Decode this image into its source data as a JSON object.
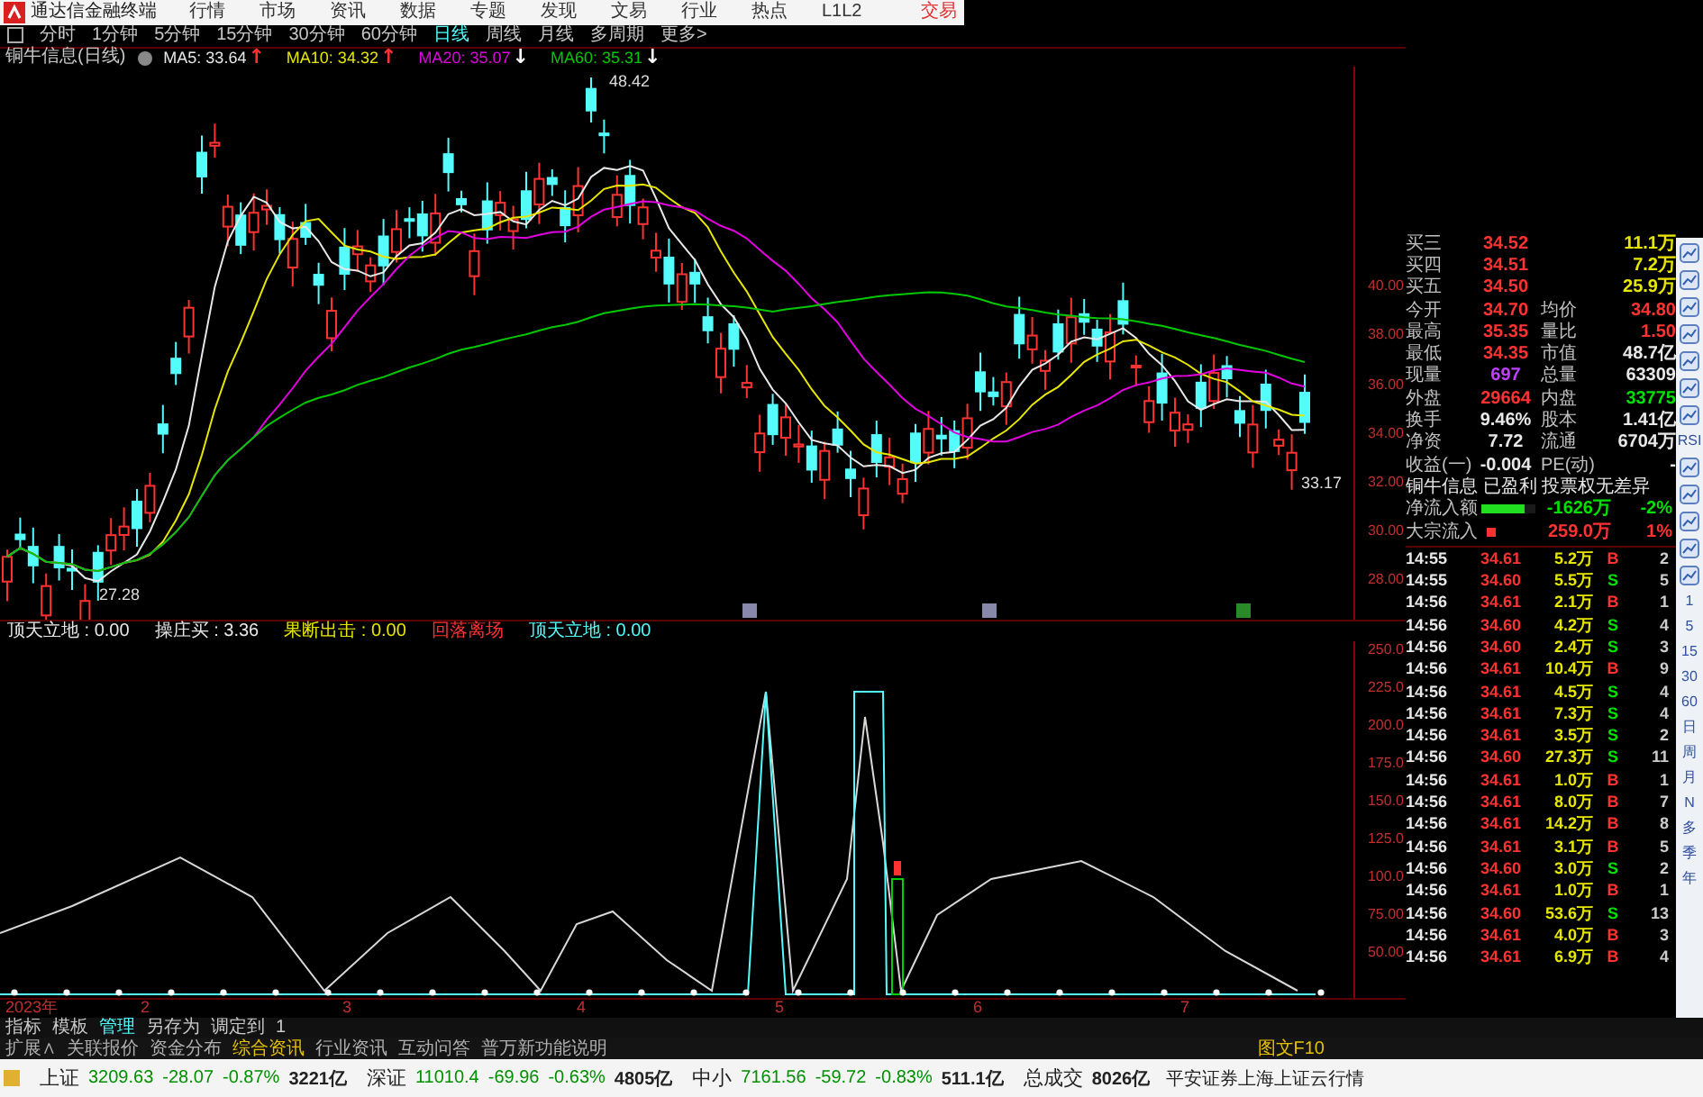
{
  "app_bar": {
    "title": "通达信金融终端",
    "menus": [
      "行情",
      "市场",
      "资讯",
      "数据",
      "专题",
      "发现",
      "文易",
      "行业",
      "热点",
      "L1L2"
    ],
    "trade": "交易"
  },
  "periods": [
    {
      "label": "分时",
      "selected": false
    },
    {
      "label": "1分钟",
      "selected": false
    },
    {
      "label": "5分钟",
      "selected": false
    },
    {
      "label": "15分钟",
      "selected": false
    },
    {
      "label": "30分钟",
      "selected": false
    },
    {
      "label": "60分钟",
      "selected": false
    },
    {
      "label": "日线",
      "selected": true
    },
    {
      "label": "周线",
      "selected": false
    },
    {
      "label": "月线",
      "selected": false
    },
    {
      "label": "多周期",
      "selected": false
    },
    {
      "label": "更多>",
      "selected": false
    }
  ],
  "chart_title": "铜牛信息(日线)",
  "moving_averages": [
    {
      "label": "MA5: 33.64",
      "color": "#e8e8e8",
      "arrow": {
        "text": "↑",
        "color": "#ff3232"
      }
    },
    {
      "label": "MA10: 34.32",
      "color": "#e6e600",
      "arrow": {
        "text": "↑",
        "color": "#ff3232"
      }
    },
    {
      "label": "MA20: 35.07",
      "color": "#e000e0",
      "arrow": {
        "text": "↓",
        "color": "#ffffff"
      }
    },
    {
      "label": "MA60: 35.31",
      "color": "#00c800",
      "arrow": {
        "text": "↓",
        "color": "#ffffff"
      }
    }
  ],
  "main_chart": {
    "high_label": "48.42",
    "low_label": "27.28",
    "last_label": "33.17",
    "axis": [
      "40.00",
      "38.00",
      "36.00",
      "34.00",
      "32.00",
      "30.00",
      "28.00"
    ]
  },
  "indicator_header": [
    {
      "text": "顶天立地 : 0.00",
      "color": "#e8e8e8"
    },
    {
      "text": "操庄买 : 3.36",
      "color": "#e8e8e8"
    },
    {
      "text": "果断出击 : 0.00",
      "color": "#e6e600"
    },
    {
      "text": "回落离场",
      "color": "#ff3232"
    },
    {
      "text": "顶天立地 : 0.00",
      "color": "#54fcfc"
    }
  ],
  "indicator_axis": [
    "250.0",
    "225.0",
    "200.0",
    "175.0",
    "150.0",
    "125.0",
    "100.0",
    "75.00",
    "50.00"
  ],
  "x_axis": [
    "2023年",
    "2",
    "3",
    "4",
    "5",
    "6",
    "7"
  ],
  "quote": [
    {
      "kind": "order",
      "cells": [
        {
          "text": "买三",
          "color": "#c0c0c0"
        },
        {
          "text": "34.52",
          "color": "#ff3232"
        },
        {
          "text": "11.1万",
          "color": "#e6e600"
        }
      ]
    },
    {
      "kind": "order",
      "cells": [
        {
          "text": "买四",
          "color": "#c0c0c0"
        },
        {
          "text": "34.51",
          "color": "#ff3232"
        },
        {
          "text": "7.2万",
          "color": "#e6e600"
        }
      ]
    },
    {
      "kind": "order",
      "cells": [
        {
          "text": "买五",
          "color": "#c0c0c0"
        },
        {
          "text": "34.50",
          "color": "#ff3232"
        },
        {
          "text": "25.9万",
          "color": "#e6e600"
        }
      ]
    },
    {
      "kind": "pair",
      "cells": [
        {
          "text": "今开",
          "color": "#c0c0c0"
        },
        {
          "text": "34.70",
          "color": "#ff3232"
        },
        {
          "text": "均价",
          "color": "#c0c0c0"
        },
        {
          "text": "34.80",
          "color": "#ff3232"
        }
      ]
    },
    {
      "kind": "pair",
      "cells": [
        {
          "text": "最高",
          "color": "#c0c0c0"
        },
        {
          "text": "35.35",
          "color": "#ff3232"
        },
        {
          "text": "量比",
          "color": "#c0c0c0"
        },
        {
          "text": "1.50",
          "color": "#ff3232"
        }
      ]
    },
    {
      "kind": "pair",
      "cells": [
        {
          "text": "最低",
          "color": "#c0c0c0"
        },
        {
          "text": "34.35",
          "color": "#ff3232"
        },
        {
          "text": "市值",
          "color": "#c0c0c0"
        },
        {
          "text": "48.7亿",
          "color": "#e8e8e8"
        }
      ]
    },
    {
      "kind": "pair",
      "cells": [
        {
          "text": "现量",
          "color": "#c0c0c0"
        },
        {
          "text": "697",
          "color": "#c040ff"
        },
        {
          "text": "总量",
          "color": "#c0c0c0"
        },
        {
          "text": "63309",
          "color": "#e8e8e8"
        }
      ]
    },
    {
      "kind": "pair",
      "cells": [
        {
          "text": "外盘",
          "color": "#c0c0c0"
        },
        {
          "text": "29664",
          "color": "#ff3232"
        },
        {
          "text": "内盘",
          "color": "#c0c0c0"
        },
        {
          "text": "33775",
          "color": "#00e000"
        }
      ]
    },
    {
      "kind": "pair",
      "cells": [
        {
          "text": "换手",
          "color": "#c0c0c0"
        },
        {
          "text": "9.46%",
          "color": "#e8e8e8"
        },
        {
          "text": "股本",
          "color": "#c0c0c0"
        },
        {
          "text": "1.41亿",
          "color": "#e8e8e8"
        }
      ]
    },
    {
      "kind": "pair",
      "cells": [
        {
          "text": "净资",
          "color": "#c0c0c0"
        },
        {
          "text": "7.72",
          "color": "#e8e8e8"
        },
        {
          "text": "流通",
          "color": "#c0c0c0"
        },
        {
          "text": "6704万",
          "color": "#e8e8e8"
        }
      ]
    },
    {
      "kind": "pair",
      "cells": [
        {
          "text": "收益(一)",
          "color": "#c0c0c0"
        },
        {
          "text": "-0.004",
          "color": "#e8e8e8"
        },
        {
          "text": "PE(动)",
          "color": "#c0c0c0"
        },
        {
          "text": "-",
          "color": "#e8e8e8"
        }
      ]
    },
    {
      "kind": "info",
      "cells": [
        {
          "text": "铜牛信息 已盈利 投票权无差异",
          "color": "#e8e8e8"
        }
      ]
    },
    {
      "kind": "flow_bar",
      "level": 0.8,
      "cells": [
        {
          "text": "净流入额",
          "color": "#c0c0c0"
        },
        {
          "text": "-1626万",
          "color": "#00e000"
        },
        {
          "text": "-2%",
          "color": "#00e000"
        }
      ]
    },
    {
      "kind": "flow_dot",
      "cells": [
        {
          "text": "大宗流入",
          "color": "#c0c0c0"
        },
        {
          "text": "259.0万",
          "color": "#ff3232"
        },
        {
          "text": "1%",
          "color": "#ff3232"
        }
      ]
    }
  ],
  "ticks": [
    {
      "time": "14:55",
      "price": "34.61",
      "volume": "5.2万",
      "side": "B",
      "kind": "buy",
      "count": "2"
    },
    {
      "time": "14:55",
      "price": "34.60",
      "volume": "5.5万",
      "side": "S",
      "kind": "sell",
      "count": "5"
    },
    {
      "time": "14:56",
      "price": "34.61",
      "volume": "2.1万",
      "side": "B",
      "kind": "buy",
      "count": "1"
    },
    {
      "time": "14:56",
      "price": "34.60",
      "volume": "4.2万",
      "side": "S",
      "kind": "sell",
      "count": "4"
    },
    {
      "time": "14:56",
      "price": "34.60",
      "volume": "2.4万",
      "side": "S",
      "kind": "sell",
      "count": "3"
    },
    {
      "time": "14:56",
      "price": "34.61",
      "volume": "10.4万",
      "side": "B",
      "kind": "buy",
      "count": "9"
    },
    {
      "time": "14:56",
      "price": "34.61",
      "volume": "4.5万",
      "side": "S",
      "kind": "sell",
      "count": "4"
    },
    {
      "time": "14:56",
      "price": "34.61",
      "volume": "7.3万",
      "side": "S",
      "kind": "sell",
      "count": "4"
    },
    {
      "time": "14:56",
      "price": "34.61",
      "volume": "3.5万",
      "side": "S",
      "kind": "sell",
      "count": "2"
    },
    {
      "time": "14:56",
      "price": "34.60",
      "volume": "27.3万",
      "side": "S",
      "kind": "sell",
      "count": "11"
    },
    {
      "time": "14:56",
      "price": "34.61",
      "volume": "1.0万",
      "side": "B",
      "kind": "buy",
      "count": "1"
    },
    {
      "time": "14:56",
      "price": "34.61",
      "volume": "8.0万",
      "side": "B",
      "kind": "buy",
      "count": "7"
    },
    {
      "time": "14:56",
      "price": "34.61",
      "volume": "14.2万",
      "side": "B",
      "kind": "buy",
      "count": "8"
    },
    {
      "time": "14:56",
      "price": "34.61",
      "volume": "3.1万",
      "side": "B",
      "kind": "buy",
      "count": "5"
    },
    {
      "time": "14:56",
      "price": "34.60",
      "volume": "3.0万",
      "side": "S",
      "kind": "sell",
      "count": "2"
    },
    {
      "time": "14:56",
      "price": "34.61",
      "volume": "1.0万",
      "side": "B",
      "kind": "buy",
      "count": "1"
    },
    {
      "time": "14:56",
      "price": "34.60",
      "volume": "53.6万",
      "side": "S",
      "kind": "sell",
      "count": "13"
    },
    {
      "time": "14:56",
      "price": "34.61",
      "volume": "4.0万",
      "side": "B",
      "kind": "buy",
      "count": "3"
    },
    {
      "time": "14:56",
      "price": "34.61",
      "volume": "6.9万",
      "side": "B",
      "kind": "buy",
      "count": "4"
    }
  ],
  "toolbar": [
    {
      "kind": "icon"
    },
    {
      "kind": "icon"
    },
    {
      "kind": "icon"
    },
    {
      "kind": "icon"
    },
    {
      "kind": "icon"
    },
    {
      "kind": "icon"
    },
    {
      "kind": "icon"
    },
    {
      "kind": "text",
      "label": "RSI"
    },
    {
      "kind": "icon"
    },
    {
      "kind": "icon"
    },
    {
      "kind": "icon"
    },
    {
      "kind": "icon"
    },
    {
      "kind": "icon"
    },
    {
      "kind": "text",
      "label": "1"
    },
    {
      "kind": "text",
      "label": "5"
    },
    {
      "kind": "text",
      "label": "15"
    },
    {
      "kind": "text",
      "label": "30"
    },
    {
      "kind": "text",
      "label": "60"
    },
    {
      "kind": "text",
      "label": "日"
    },
    {
      "kind": "text",
      "label": "周"
    },
    {
      "kind": "text",
      "label": "月"
    },
    {
      "kind": "text",
      "label": "N"
    },
    {
      "kind": "text",
      "label": "多"
    },
    {
      "kind": "text",
      "label": "季"
    },
    {
      "kind": "text",
      "label": "年"
    }
  ],
  "indicator_tabs": [
    {
      "label": "指标",
      "selected": false
    },
    {
      "label": "模板",
      "selected": false
    },
    {
      "label": "管理",
      "selected": true
    },
    {
      "label": "另存为",
      "selected": false
    },
    {
      "label": "调定到",
      "selected": false
    },
    {
      "label": "1",
      "selected": false
    }
  ],
  "info_tabs": [
    {
      "label": "扩展∧",
      "selected": false
    },
    {
      "label": "关联报价",
      "selected": false
    },
    {
      "label": "资金分布",
      "selected": false
    },
    {
      "label": "综合资讯",
      "selected": true
    },
    {
      "label": "行业资讯",
      "selected": false
    },
    {
      "label": "互动问答",
      "selected": false
    },
    {
      "label": "普万新功能说明",
      "selected": false
    }
  ],
  "f10": "图文F10",
  "status_bar": [
    {
      "name": "上证",
      "value": "3209.63",
      "change": "-28.07",
      "percent": "-0.87%",
      "amount": "3221亿"
    },
    {
      "name": "深证",
      "value": "11010.4",
      "change": "-69.96",
      "percent": "-0.63%",
      "amount": "4805亿"
    },
    {
      "name": "中小",
      "value": "7161.56",
      "change": "-59.72",
      "percent": "-0.83%",
      "amount": "511.1亿"
    }
  ],
  "total": {
    "name": "总成交",
    "amount": "8026亿"
  },
  "broker": "平安证券上海上证云行情"
}
